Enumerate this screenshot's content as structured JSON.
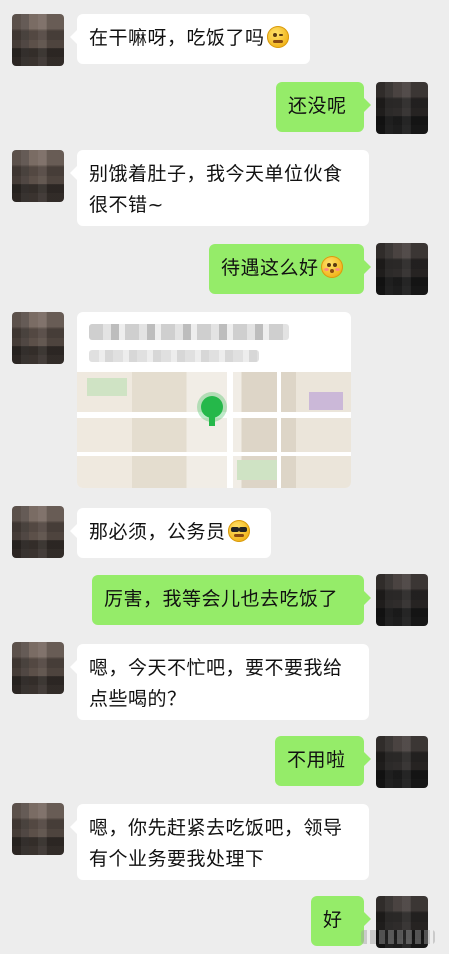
{
  "messages": [
    {
      "side": "left",
      "text": "在干嘛呀，吃饭了吗",
      "emoji": "wink-smiley-emoji"
    },
    {
      "side": "right",
      "text": "还没呢"
    },
    {
      "side": "left",
      "lines": [
        "别饿着肚子，我今天单位伙食",
        "很不错~"
      ]
    },
    {
      "side": "right",
      "text": "待遇这么好",
      "emoji": "flushed-face-emoji"
    },
    {
      "side": "left",
      "type": "location",
      "icon": "map-pin-icon"
    },
    {
      "side": "left",
      "text": "那必须，公务员",
      "emoji": "sunglasses-face-emoji"
    },
    {
      "side": "right",
      "text": "厉害，我等会儿也去吃饭了"
    },
    {
      "side": "left",
      "lines": [
        "嗯，今天不忙吧，要不要我给",
        "点些喝的？"
      ]
    },
    {
      "side": "right",
      "text": "不用啦"
    },
    {
      "side": "left",
      "lines": [
        "嗯，你先赶紧去吃饭吧，领导",
        "有个业务要我处理下"
      ]
    },
    {
      "side": "right",
      "text": "好"
    }
  ],
  "colors": {
    "background": "#ededed",
    "bubble_self": "#95ec69",
    "bubble_other": "#ffffff",
    "map_pin": "#25b84a"
  }
}
